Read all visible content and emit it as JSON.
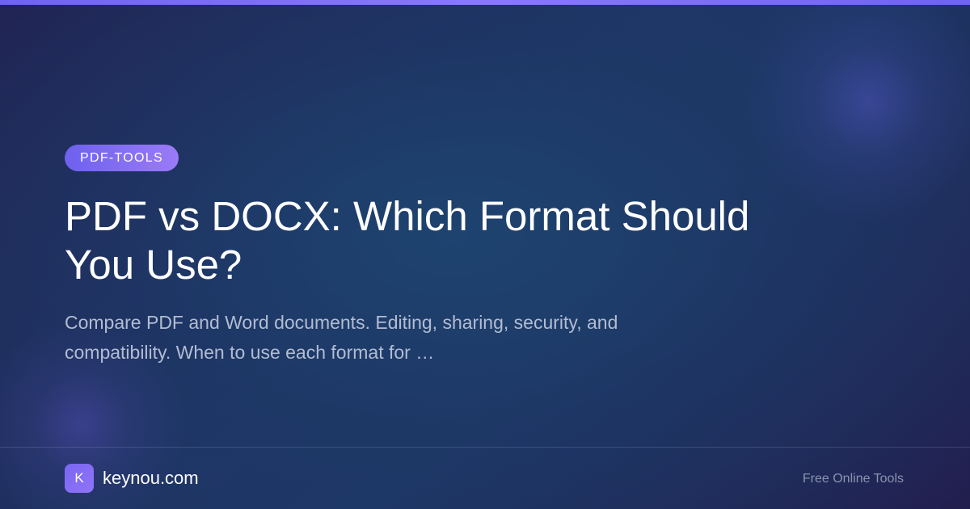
{
  "category_badge": "PDF-TOOLS",
  "title": "PDF vs DOCX: Which Format Should You Use?",
  "description": "Compare PDF and Word documents. Editing, sharing, security, and compatibility. When to use each format for …",
  "footer": {
    "logo_letter": "K",
    "site_name": "keynou.com",
    "tagline": "Free Online Tools"
  },
  "colors": {
    "accent": "#7a66f3",
    "background": "#1f3464",
    "text": "#ffffff",
    "muted_text": "#b2bcd2"
  }
}
